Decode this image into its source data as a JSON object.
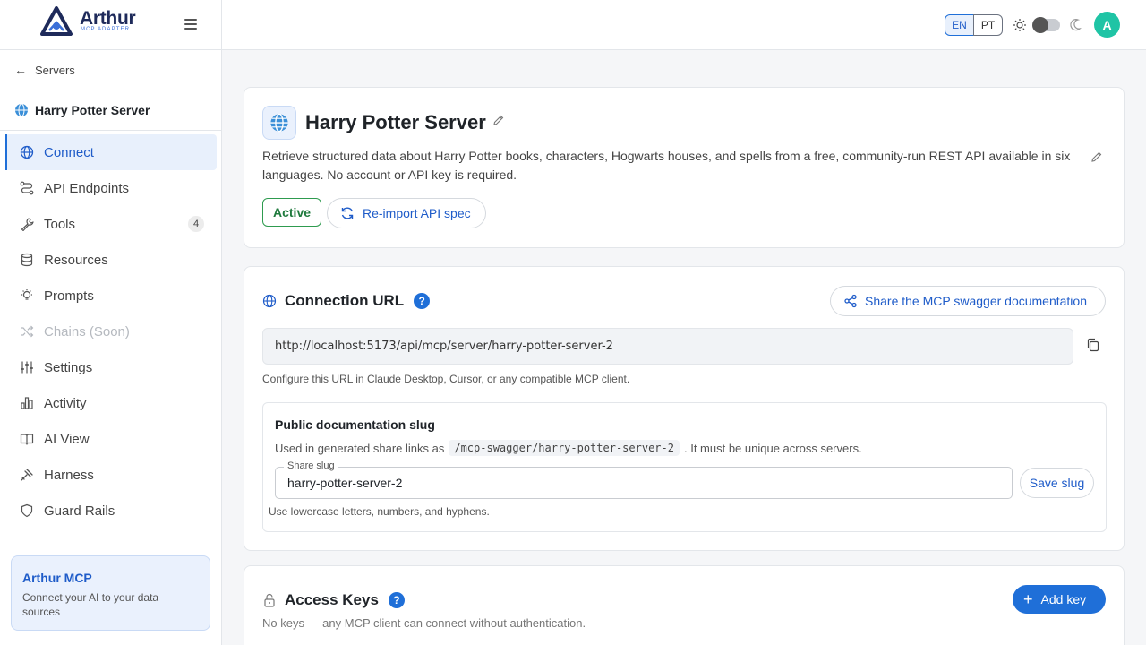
{
  "brand": {
    "name": "Arthur",
    "subtitle": "MCP ADAPTER"
  },
  "sidebar": {
    "back_label": "Servers",
    "server_name": "Harry Potter Server",
    "items": [
      {
        "label": "Connect",
        "icon": "globe-icon",
        "active": true
      },
      {
        "label": "API Endpoints",
        "icon": "route-icon"
      },
      {
        "label": "Tools",
        "icon": "wrench-icon",
        "badge": "4"
      },
      {
        "label": "Resources",
        "icon": "database-icon"
      },
      {
        "label": "Prompts",
        "icon": "lightbulb-icon"
      },
      {
        "label": "Chains (Soon)",
        "icon": "shuffle-icon",
        "disabled": true
      },
      {
        "label": "Settings",
        "icon": "sliders-icon"
      },
      {
        "label": "Activity",
        "icon": "bar-chart-icon"
      },
      {
        "label": "AI View",
        "icon": "book-icon"
      },
      {
        "label": "Harness",
        "icon": "harness-icon"
      },
      {
        "label": "Guard Rails",
        "icon": "shield-icon"
      }
    ],
    "promo": {
      "title": "Arthur MCP",
      "text": "Connect your AI to your data sources"
    }
  },
  "topbar": {
    "lang_en": "EN",
    "lang_pt": "PT",
    "avatar_initial": "A",
    "theme_dark": false
  },
  "server": {
    "title": "Harry Potter Server",
    "description": "Retrieve structured data about Harry Potter books, characters, Hogwarts houses, and spells from a free, community-run REST API available in six languages. No account or API key is required.",
    "status": "Active",
    "reimport_label": "Re-import API spec"
  },
  "connection": {
    "title": "Connection URL",
    "help": "?",
    "share_label": "Share the MCP swagger documentation",
    "url": "http://localhost:5173/api/mcp/server/harry-potter-server-2",
    "help_text": "Configure this URL in Claude Desktop, Cursor, or any compatible MCP client.",
    "slug": {
      "title": "Public documentation slug",
      "desc_before": "Used in generated share links as",
      "desc_code": "/mcp-swagger/harry-potter-server-2",
      "desc_after": ". It must be unique across servers.",
      "input_label": "Share slug",
      "input_value": "harry-potter-server-2",
      "save_label": "Save slug",
      "hint": "Use lowercase letters, numbers, and hyphens."
    }
  },
  "access_keys": {
    "title": "Access Keys",
    "help": "?",
    "add_label": "Add key",
    "empty_text": "No keys — any MCP client can connect without authentication."
  },
  "colors": {
    "accent": "#1f6fd8",
    "active_green": "#2e9b4f",
    "avatar": "#1fc4a5"
  }
}
